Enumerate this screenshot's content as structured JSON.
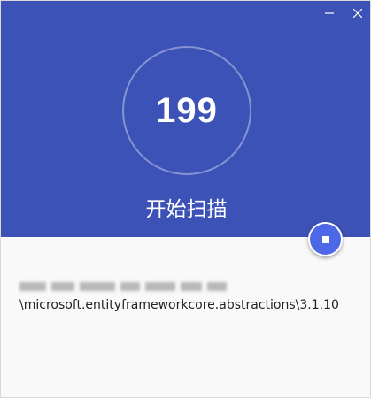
{
  "window": {
    "controls": {
      "minimize": "minimize-icon",
      "close": "close-icon"
    }
  },
  "scan": {
    "count": "199",
    "title": "开始扫描",
    "action_icon": "stop-icon"
  },
  "current_path": {
    "path_text": "\\microsoft.entityframeworkcore.abstractions\\3.1.10"
  },
  "colors": {
    "header_background": "#3d52b6",
    "body_background": "#f9f9f9",
    "action_button": "#4d68e6"
  }
}
